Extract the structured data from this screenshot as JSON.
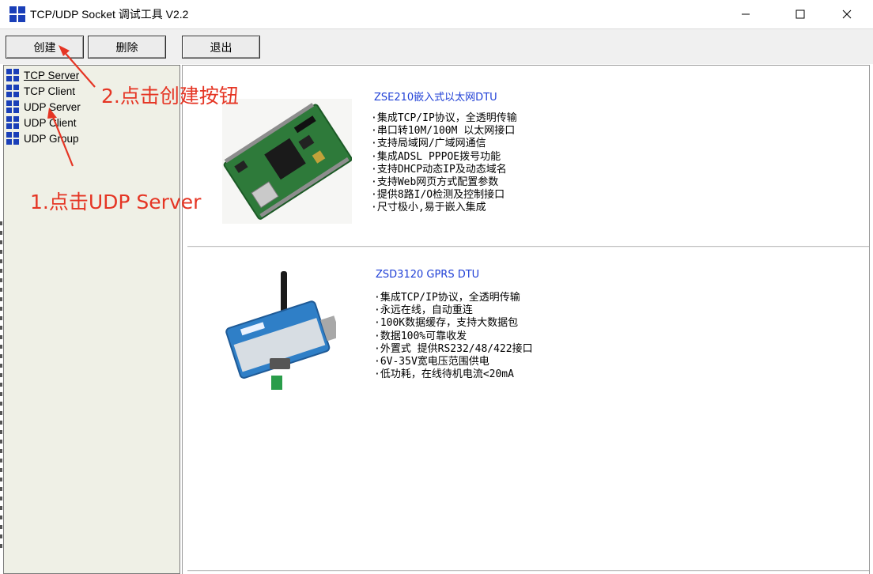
{
  "window": {
    "title": "TCP/UDP Socket 调试工具 V2.2"
  },
  "toolbar": {
    "create_label": "创建",
    "delete_label": "删除",
    "exit_label": "退出"
  },
  "tree": {
    "items": [
      {
        "label": "TCP Server"
      },
      {
        "label": "TCP Client"
      },
      {
        "label": "UDP Server"
      },
      {
        "label": "UDP Client"
      },
      {
        "label": "UDP Group"
      }
    ]
  },
  "products": [
    {
      "name": "ZSE210嵌入式以太网DTU",
      "features": [
        "·集成TCP/IP协议，全透明传输",
        "·串口转10M/100M 以太网接口",
        "·支持局域网/广域网通信",
        "·集成ADSL PPPOE拨号功能",
        "·支持DHCP动态IP及动态域名",
        "·支持Web网页方式配置参数",
        "·提供8路I/O检测及控制接口",
        "·尺寸极小,易于嵌入集成"
      ]
    },
    {
      "name": "ZSD3120 GPRS DTU",
      "features": [
        "·集成TCP/IP协议，全透明传输",
        "·永远在线，自动重连",
        "·100K数据缓存，支持大数据包",
        "·数据100%可靠收发",
        "·外置式 提供RS232/48/422接口",
        "·6V-35V宽电压范围供电",
        "·低功耗，在线待机电流<20mA"
      ]
    }
  ],
  "annotations": {
    "step2": "2.点击创建按钮",
    "step1": "1.点击UDP Server"
  },
  "colors": {
    "annotation": "#e53524",
    "product_title": "#1f3fd6",
    "tree_bg": "#eff0e6"
  }
}
